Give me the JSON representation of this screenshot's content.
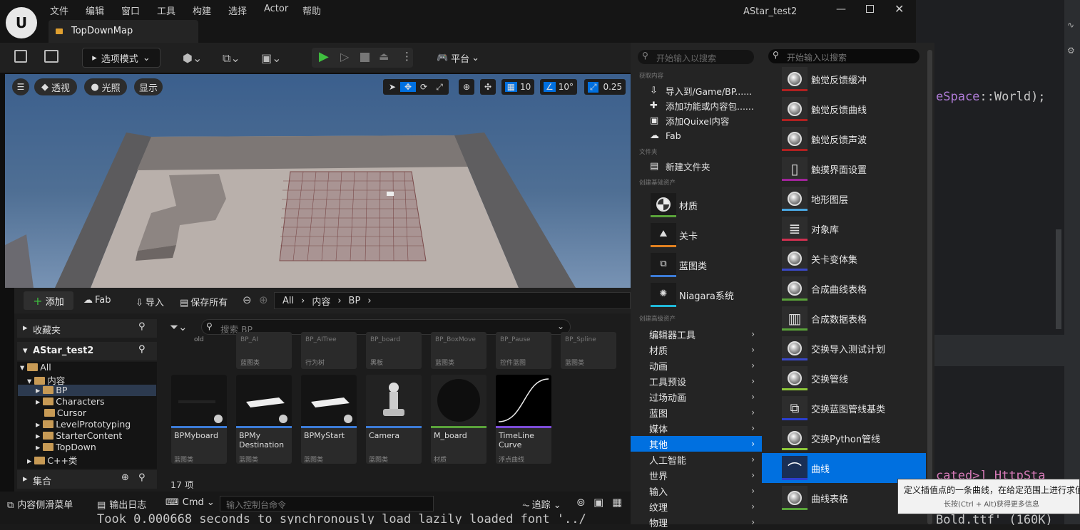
{
  "window": {
    "title": "AStar_test2",
    "tab": "TopDownMap"
  },
  "menubar": [
    "文件",
    "编辑",
    "窗口",
    "工具",
    "构建",
    "选择",
    "Actor",
    "帮助"
  ],
  "toolbar": {
    "mode": "选项模式",
    "platform": "平台"
  },
  "viewport": {
    "perspective": "透视",
    "lighting": "光照",
    "show": "显示",
    "grid": "10",
    "angle": "10°",
    "scale": "0.25"
  },
  "content_browser": {
    "add": "添加",
    "fab": "Fab",
    "import": "导入",
    "save_all": "保存所有",
    "breadcrumb": [
      "All",
      "内容",
      "BP"
    ],
    "search_placeholder": "搜索 BP",
    "favorites": "收藏夹",
    "project": "AStar_test2",
    "collections": "集合",
    "count": "17 项",
    "tree": [
      "All",
      "内容",
      "BP",
      "Characters",
      "Cursor",
      "LevelPrototyping",
      "StarterContent",
      "TopDown",
      "C++类"
    ],
    "top_row": [
      {
        "name": "old",
        "type": ""
      },
      {
        "name": "BP_AI",
        "type": "蓝图类"
      },
      {
        "name": "BP_AITree",
        "type": "行为树"
      },
      {
        "name": "BP_board",
        "type": "黑板"
      },
      {
        "name": "BP_BoxMove",
        "type": "蓝图类"
      },
      {
        "name": "BP_Pause",
        "type": "控件蓝图"
      },
      {
        "name": "BP_Spline",
        "type": "蓝图类"
      }
    ],
    "assets": [
      {
        "name": "BPMyboard",
        "type": "蓝图类",
        "bar": "#3c7bd6"
      },
      {
        "name": "BPMy Destination",
        "type": "蓝图类",
        "bar": "#3c7bd6"
      },
      {
        "name": "BPMyStart",
        "type": "蓝图类",
        "bar": "#3c7bd6"
      },
      {
        "name": "Camera",
        "type": "蓝图类",
        "bar": "#3c7bd6"
      },
      {
        "name": "M_board",
        "type": "材质",
        "bar": "#5aa33a"
      },
      {
        "name": "TimeLine Curve",
        "type": "浮点曲线",
        "bar": "#7b4bd6"
      }
    ]
  },
  "status": {
    "drawer": "内容侧滑菜单",
    "output": "输出日志",
    "cmd": "Cmd",
    "console_placeholder": "输入控制台命令",
    "trace": "追踪"
  },
  "console_text": "Took 0.000668 seconds to synchronously load lazily loaded font '../",
  "code": {
    "l1": "eSpace::World);",
    "l2": "cated>]  HttpSta",
    "l3": "Bold.ttf' (160K)"
  },
  "menu1": {
    "search_placeholder": "开始输入以搜索",
    "sec_get": "获取内容",
    "sec_folder": "文件夹",
    "sec_basic": "创建基础资产",
    "sec_adv": "创建高级资产",
    "get": [
      "导入到/Game/BP......",
      "添加功能或内容包......",
      "添加Quixel内容",
      "Fab"
    ],
    "new_folder": "新建文件夹",
    "basic": [
      "材质",
      "关卡",
      "蓝图类",
      "Niagara系统"
    ],
    "adv": [
      "编辑器工具",
      "材质",
      "动画",
      "工具预设",
      "过场动画",
      "蓝图",
      "媒体",
      "其他",
      "人工智能",
      "世界",
      "输入",
      "纹理",
      "物理"
    ]
  },
  "menu2": {
    "search_placeholder": "开始输入以搜索",
    "items": [
      {
        "label": "触觉反馈缓冲",
        "bar": "#b02020"
      },
      {
        "label": "触觉反馈曲线",
        "bar": "#b02020"
      },
      {
        "label": "触觉反馈声波",
        "bar": "#b02020"
      },
      {
        "label": "触摸界面设置",
        "bar": "#a0249a"
      },
      {
        "label": "地形图层",
        "bar": "#4aa6e0"
      },
      {
        "label": "对象库",
        "bar": "#d03050"
      },
      {
        "label": "关卡变体集",
        "bar": "#3b49c8"
      },
      {
        "label": "合成曲线表格",
        "bar": "#5aa33a"
      },
      {
        "label": "合成数据表格",
        "bar": "#5aa33a"
      },
      {
        "label": "交换导入测试计划",
        "bar": "#3b49c8"
      },
      {
        "label": "交换管线",
        "bar": "#8ec83a"
      },
      {
        "label": "交换蓝图管线基类",
        "bar": "#2b3fd0"
      },
      {
        "label": "交换Python管线",
        "bar": "#8ec83a"
      },
      {
        "label": "曲线",
        "bar": "#2b3fd0"
      },
      {
        "label": "曲线表格",
        "bar": "#5aa33a"
      }
    ]
  },
  "tooltip": {
    "line1": "定义插值点的一条曲线，在给定范围上进行求值",
    "line2": "长按(Ctrl + Alt)获得更多信息"
  },
  "colors": {
    "accent": "#0070e0",
    "play": "#3fbf3f"
  }
}
